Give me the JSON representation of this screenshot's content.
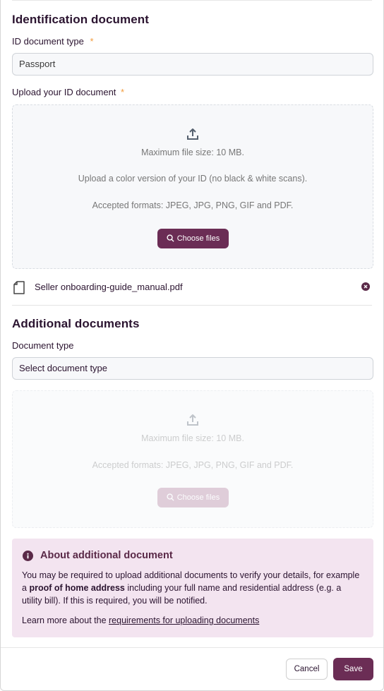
{
  "id_section": {
    "title": "Identification document",
    "doc_type_label": "ID document type",
    "required_mark": "*",
    "doc_type_value": "Passport",
    "upload_label": "Upload your ID document",
    "dropzone": {
      "max_size": "Maximum file size: 10 MB.",
      "color_note": "Upload a color version of your ID (no black & white scans).",
      "formats": "Accepted formats: JPEG, JPG, PNG, GIF and PDF.",
      "button": "Choose files"
    },
    "uploaded_file": {
      "name": "Seller onboarding-guide_manual.pdf",
      "file_icon": "document-icon",
      "remove_icon": "close-circle-icon"
    }
  },
  "additional_section": {
    "title": "Additional documents",
    "doc_type_label": "Document type",
    "doc_type_value": "Select document type",
    "dropzone": {
      "max_size": "Maximum file size: 10 MB.",
      "formats": "Accepted formats: JPEG, JPG, PNG, GIF and PDF.",
      "button": "Choose files",
      "disabled": true
    }
  },
  "info_box": {
    "title": "About additional document",
    "body_part1": "You may be required to upload additional documents to verify your details, for example a ",
    "body_bold": "proof of home address",
    "body_part2": " including your full name and residential address (e.g. a utility bill). If this is required, you will be notified.",
    "learn_prefix": "Learn more about the ",
    "learn_link": "requirements for uploading documents",
    "background": "#f3e4f0"
  },
  "footer": {
    "cancel_label": "Cancel",
    "save_label": "Save"
  },
  "colors": {
    "brand": "#6b2d55",
    "required": "#f29b3c"
  }
}
